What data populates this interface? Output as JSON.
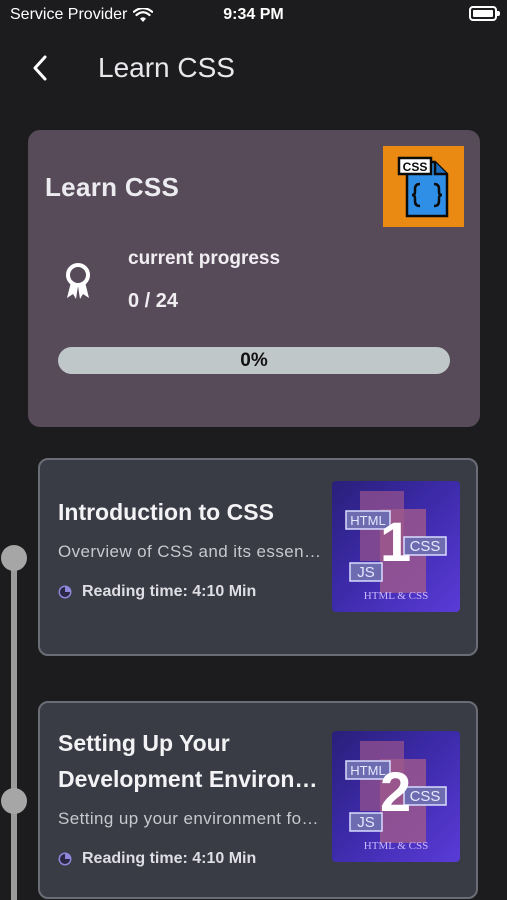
{
  "status": {
    "carrier": "Service Provider",
    "time": "9:34 PM"
  },
  "nav": {
    "title": "Learn CSS"
  },
  "course": {
    "title": "Learn CSS",
    "thumb_label": "CSS",
    "progress_label": "current progress",
    "progress_count": "0 / 24",
    "progress_percent_text": "0%",
    "progress_fraction": 0
  },
  "lessons": [
    {
      "number": "1",
      "title": "Introduction to CSS",
      "description": "Overview of CSS and its essential concepts",
      "reading_time": "Reading time: 4:10 Min",
      "thumb_tags": [
        "HTML",
        "CSS",
        "JS"
      ],
      "thumb_caption": "HTML & CSS"
    },
    {
      "number": "2",
      "title_lines": [
        "Setting Up Your",
        "Development Environment"
      ],
      "description": "Setting up your environment for CSS",
      "reading_time": "Reading time: 4:10 Min",
      "thumb_tags": [
        "HTML",
        "CSS",
        "JS"
      ],
      "thumb_caption": "HTML & CSS"
    }
  ],
  "colors": {
    "background": "#1c1c1e",
    "course_card": "#574b5a",
    "lesson_card": "#393b45",
    "thumb_orange": "#ea8a12",
    "progress_track": "#c0c7c9"
  },
  "icons": {
    "back": "chevron-left-icon",
    "award": "award-icon",
    "clock": "clock-icon",
    "wifi": "wifi-icon",
    "battery": "battery-icon",
    "css_file": "css-file-icon"
  }
}
